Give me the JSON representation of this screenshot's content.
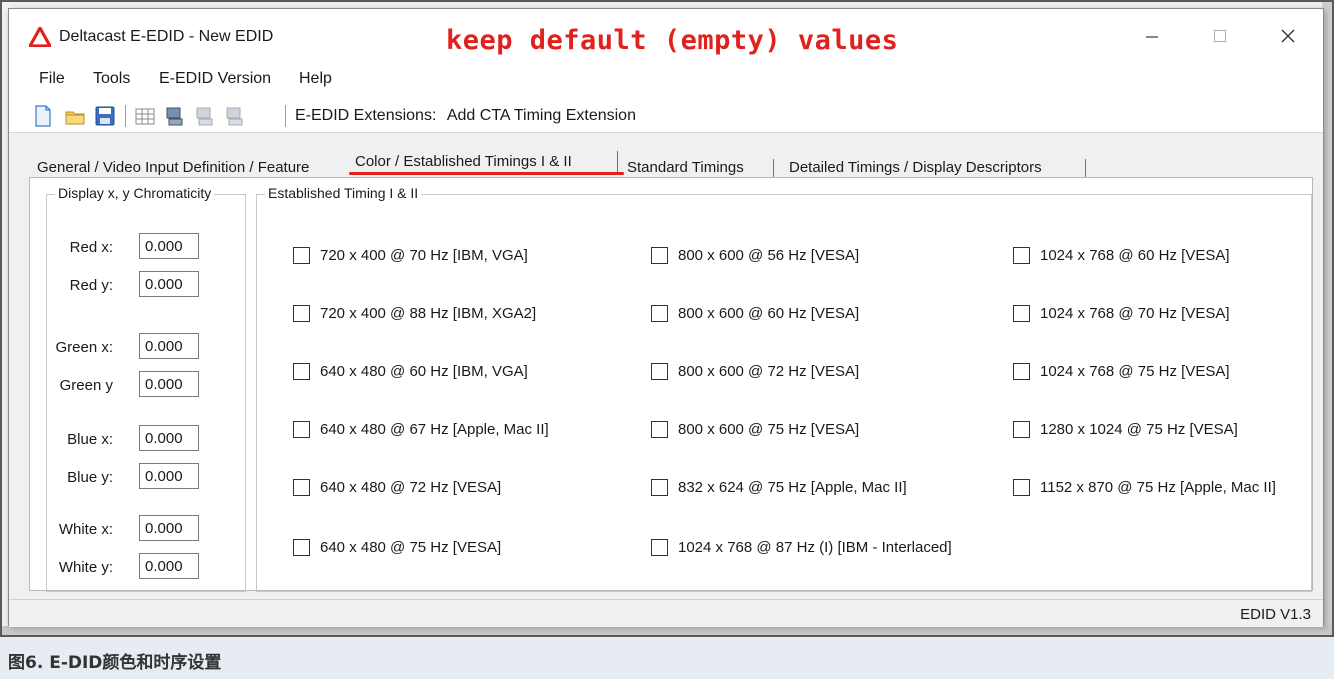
{
  "window": {
    "title": "Deltacast E-EDID - New EDID",
    "annotation": "keep default (empty) values"
  },
  "title_controls": {
    "minimize": "—",
    "maximize": "☐",
    "close": "✕"
  },
  "menu": [
    "File",
    "Tools",
    "E-EDID Version",
    "Help"
  ],
  "toolbar": {
    "icons": [
      "new-file-icon",
      "open-folder-icon",
      "save-icon",
      "grid-view-icon",
      "device-icon",
      "device-disabled-icon",
      "device-disabled-icon"
    ],
    "extensions_label": "E-EDID Extensions:",
    "add_extension": "Add CTA Timing Extension"
  },
  "tabs": [
    {
      "label": "General / Video Input Definition / Feature",
      "active": false
    },
    {
      "label": "Color / Established Timings I & II",
      "active": true
    },
    {
      "label": "Standard Timings",
      "active": false
    },
    {
      "label": "Detailed Timings / Display Descriptors",
      "active": false
    }
  ],
  "chromaticity": {
    "legend": "Display x, y Chromaticity",
    "fields": [
      {
        "label": "Red x:",
        "value": "0.000"
      },
      {
        "label": "Red y:",
        "value": "0.000"
      },
      {
        "label": "Green x:",
        "value": "0.000"
      },
      {
        "label": "Green y",
        "value": "0.000"
      },
      {
        "label": "Blue x:",
        "value": "0.000"
      },
      {
        "label": "Blue y:",
        "value": "0.000"
      },
      {
        "label": "White x:",
        "value": "0.000"
      },
      {
        "label": "White y:",
        "value": "0.000"
      }
    ]
  },
  "established": {
    "legend": "Established Timing I & II",
    "columns": [
      [
        {
          "label": "720 x 400 @ 70 Hz   [IBM, VGA]",
          "checked": false
        },
        {
          "label": "720 x 400 @ 88 Hz  [IBM, XGA2]",
          "checked": false
        },
        {
          "label": "640 x 480 @ 60 Hz  [IBM, VGA]",
          "checked": false
        },
        {
          "label": "640 x 480 @ 67 Hz  [Apple, Mac II]",
          "checked": false
        },
        {
          "label": "640 x 480 @ 72 Hz  [VESA]",
          "checked": false
        },
        {
          "label": "640 x 480 @ 75 Hz  [VESA]",
          "checked": false
        }
      ],
      [
        {
          "label": "800 x 600 @ 56 Hz  [VESA]",
          "checked": false
        },
        {
          "label": "800 x 600 @ 60 Hz  [VESA]",
          "checked": false
        },
        {
          "label": "800 x 600 @ 72 Hz  [VESA]",
          "checked": false
        },
        {
          "label": "800 x 600 @ 75 Hz  [VESA]",
          "checked": false
        },
        {
          "label": "832 x 624 @ 75 Hz  [Apple, Mac II]",
          "checked": false
        },
        {
          "label": "1024 x 768 @ 87 Hz (I)  [IBM - Interlaced]",
          "checked": false
        }
      ],
      [
        {
          "label": "1024 x 768 @ 60 Hz  [VESA]",
          "checked": false
        },
        {
          "label": "1024 x 768 @ 70 Hz  [VESA]",
          "checked": false
        },
        {
          "label": "1024 x 768 @ 75 Hz  [VESA]",
          "checked": false
        },
        {
          "label": "1280 x 1024 @ 75 Hz  [VESA]",
          "checked": false
        },
        {
          "label": "1152 x 870 @ 75 Hz  [Apple, Mac II]",
          "checked": false
        }
      ]
    ]
  },
  "status": {
    "text": "EDID V1.3"
  },
  "caption": "图6. E-DID颜色和时序设置",
  "colors": {
    "annotation": "#e0221e",
    "tab_underline": "#e0221e"
  }
}
